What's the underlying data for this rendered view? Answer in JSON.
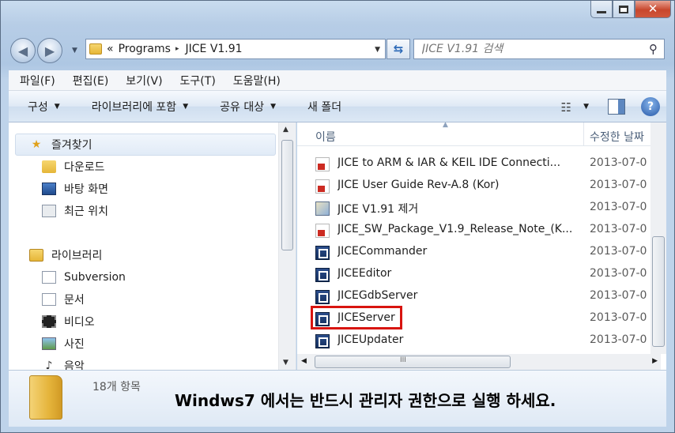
{
  "window": {
    "close_glyph": "✕"
  },
  "nav": {
    "back_glyph": "◀",
    "forward_glyph": "▶",
    "breadcrumb": [
      "Programs",
      "JICE V1.91"
    ],
    "breadcrumb_prefix": "«",
    "crumb_separator": "▸",
    "search_placeholder": "JICE V1.91 검색"
  },
  "menubar": [
    "파일(F)",
    "편집(E)",
    "보기(V)",
    "도구(T)",
    "도움말(H)"
  ],
  "commandbar": [
    "구성",
    "라이브러리에 포함",
    "공유 대상",
    "새 폴더"
  ],
  "help_glyph": "?",
  "navpane": {
    "favorites": {
      "label": "즐겨찾기",
      "icon": "star-icon"
    },
    "favorites_items": [
      {
        "label": "다운로드",
        "icon": "downloads-folder-icon"
      },
      {
        "label": "바탕 화면",
        "icon": "desktop-icon"
      },
      {
        "label": "최근 위치",
        "icon": "recent-places-icon"
      }
    ],
    "libraries": {
      "label": "라이브러리",
      "icon": "libraries-icon"
    },
    "library_items": [
      {
        "label": "Subversion",
        "icon": "document-icon"
      },
      {
        "label": "문서",
        "icon": "documents-icon"
      },
      {
        "label": "비디오",
        "icon": "video-icon"
      },
      {
        "label": "사진",
        "icon": "pictures-icon"
      },
      {
        "label": "음악",
        "icon": "music-icon"
      }
    ]
  },
  "filelist": {
    "columns": {
      "name": "이름",
      "modified": "수정한 날짜"
    },
    "files": [
      {
        "name": "JICE to ARM & IAR & KEIL IDE Connecti...",
        "date": "2013-07-0",
        "type": "pdf"
      },
      {
        "name": "JICE User Guide Rev-A.8 (Kor)",
        "date": "2013-07-0",
        "type": "pdf"
      },
      {
        "name": "JICE V1.91 제거",
        "date": "2013-07-0",
        "type": "inst"
      },
      {
        "name": "JICE_SW_Package_V1.9_Release_Note_(K...",
        "date": "2013-07-0",
        "type": "pdf"
      },
      {
        "name": "JICECommander",
        "date": "2013-07-0",
        "type": "exe"
      },
      {
        "name": "JICEEditor",
        "date": "2013-07-0",
        "type": "exe"
      },
      {
        "name": "JICEGdbServer",
        "date": "2013-07-0",
        "type": "exe"
      },
      {
        "name": "JICEServer",
        "date": "2013-07-0",
        "type": "exe",
        "highlighted": true
      },
      {
        "name": "JICEUpdater",
        "date": "2013-07-0",
        "type": "exe"
      }
    ]
  },
  "details": {
    "item_count": "18개 항목",
    "notice": "Windws7 에서는 반드시 관리자 권한으로 실행 하세요."
  }
}
